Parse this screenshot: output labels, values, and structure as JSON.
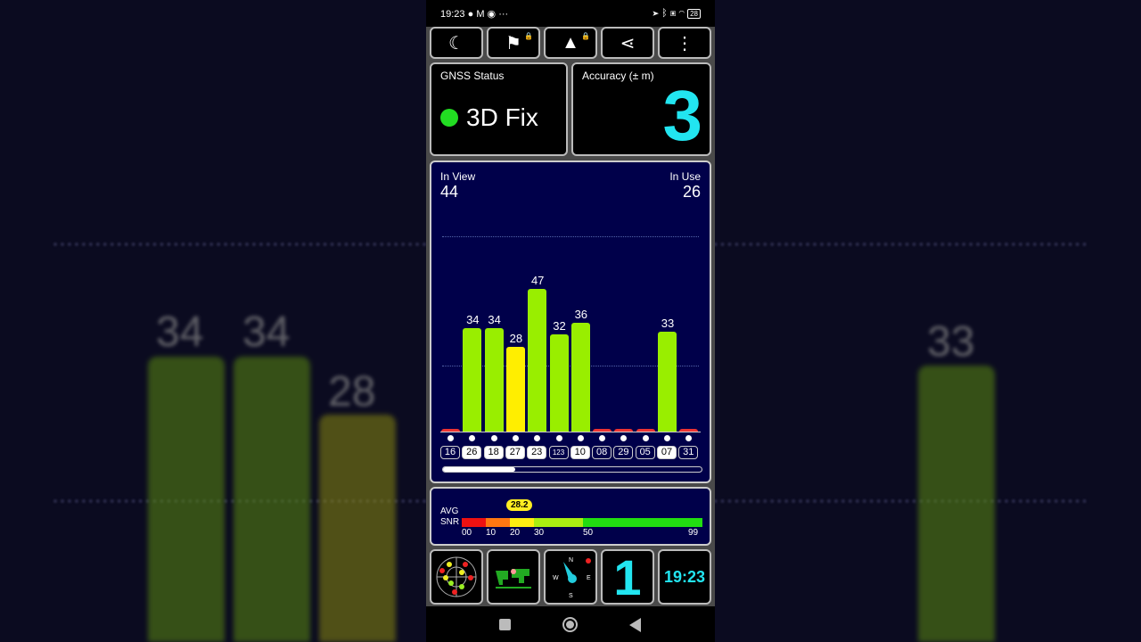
{
  "status_bar": {
    "time": "19:23",
    "icons": [
      "record-dot-icon",
      "gmail-icon",
      "chrome-icon",
      "more-dots-icon"
    ],
    "right_icons": [
      "location-icon",
      "bluetooth-icon",
      "sim-icon",
      "wifi-icon",
      "battery-icon"
    ],
    "battery": "28",
    "more": "···"
  },
  "toolbar": [
    {
      "icon": "moon-icon",
      "glyph": "☾"
    },
    {
      "icon": "person-flag-icon",
      "glyph": "⚑",
      "locked": true
    },
    {
      "icon": "navigation-arrow-icon",
      "glyph": "▲",
      "locked": true
    },
    {
      "icon": "share-icon",
      "glyph": "⋖"
    },
    {
      "icon": "more-vert-icon",
      "glyph": "⋮"
    }
  ],
  "gnss": {
    "label": "GNSS Status",
    "value": "3D Fix",
    "color": "#22dd22"
  },
  "accuracy": {
    "label": "Accuracy (± m)",
    "value": "3",
    "color": "#22e5f0"
  },
  "chart_data": {
    "type": "bar",
    "in_view_label": "In View",
    "in_view": "44",
    "in_use_label": "In Use",
    "in_use": "26",
    "categories": [
      "16",
      "26",
      "18",
      "27",
      "23",
      "123",
      "10",
      "08",
      "29",
      "05",
      "07",
      "31"
    ],
    "values": [
      0,
      34,
      34,
      28,
      47,
      32,
      36,
      0,
      0,
      0,
      33,
      0
    ],
    "in_use_flags": [
      false,
      true,
      true,
      true,
      true,
      false,
      true,
      false,
      false,
      false,
      true,
      false
    ],
    "colors": {
      "strong": "#99ee00",
      "medium": "#ffee00",
      "none": "#ee3333"
    },
    "scroll_fraction": 0.28
  },
  "snr": {
    "label1": "AVG",
    "label2": "SNR",
    "avg": "28.2",
    "ticks": [
      "00",
      "10",
      "20",
      "30",
      "50",
      "99"
    ]
  },
  "bottom": {
    "sats_used": "1",
    "clock": "19:23"
  },
  "nav": [
    "recents-button",
    "home-button",
    "back-button"
  ]
}
